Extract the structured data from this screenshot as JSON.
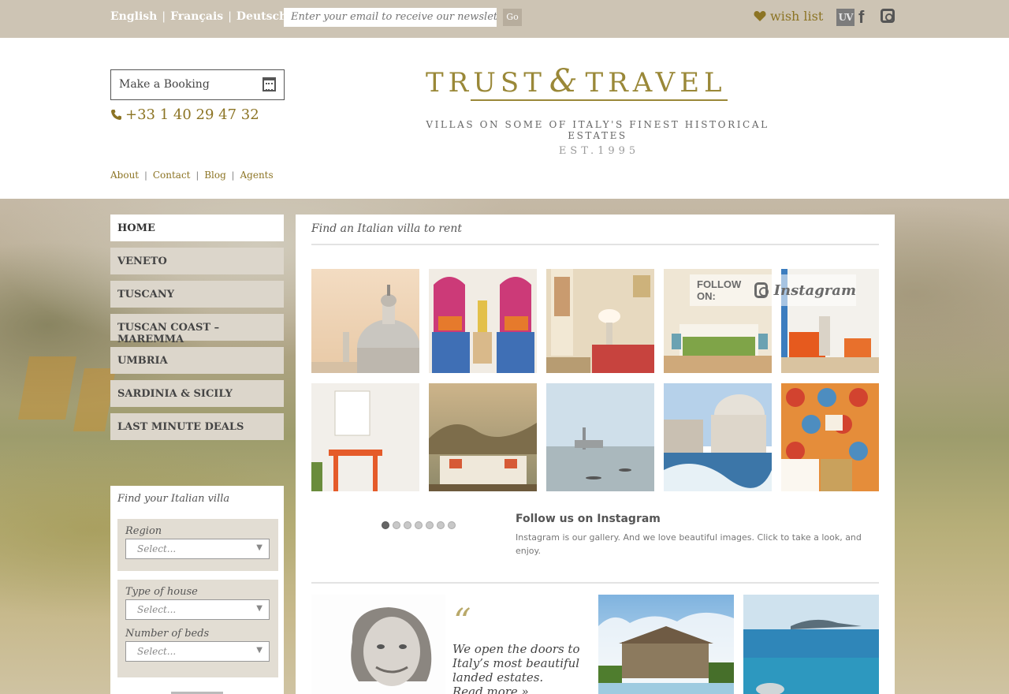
{
  "topbar": {
    "languages": [
      "English",
      "Français",
      "Deutsch"
    ],
    "newsletter_placeholder": "Enter your email to receive our newsletter",
    "go_label": "Go",
    "wish_list_label": "wish list",
    "uv_label": "UV"
  },
  "header": {
    "booking_label": "Make a Booking",
    "phone": "+33 1 40 29 47 32",
    "logo_left": "TRUST",
    "logo_amp": "&",
    "logo_right": "TRAVEL",
    "tagline": "VILLAS ON SOME OF ITALY'S FINEST HISTORICAL ESTATES",
    "est": "EST.1995",
    "links": [
      "About",
      "Contact",
      "Blog",
      "Agents"
    ]
  },
  "nav": {
    "items": [
      "HOME",
      "VENETO",
      "TUSCANY",
      "TUSCAN COAST – MAREMMA",
      "UMBRIA",
      "SARDINIA & SICILY",
      "LAST MINUTE DEALS"
    ],
    "active_index": 0
  },
  "finder": {
    "title": "Find your Italian villa",
    "region_label": "Region",
    "type_label": "Type of house",
    "beds_label": "Number of beds",
    "select_placeholder": "Select..."
  },
  "main": {
    "title": "Find an Italian villa to rent",
    "follow_badge": {
      "follow_on": "FOLLOW ON:",
      "instagram": "Instagram"
    },
    "carousel": {
      "pages": 7,
      "current": 1
    },
    "instagram_heading": "Follow us on Instagram",
    "instagram_text": "Instagram is our gallery. And we love beautiful images. Click to take a look, and enjoy.",
    "quote": "We open the doors to Italy’s most beautiful landed estates.",
    "read_more": "Read more »"
  },
  "colors": {
    "accent_gold": "#8c7424",
    "topbar": "#cdc4b4",
    "nav_bg": "#dcd6cb"
  }
}
